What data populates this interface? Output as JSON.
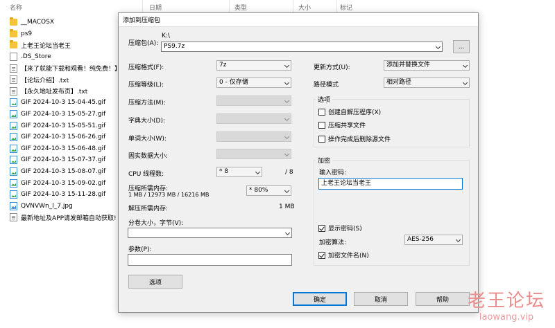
{
  "explorer": {
    "columns": [
      "名称",
      "日期",
      "类型",
      "大小",
      "标记"
    ],
    "files": [
      {
        "name": "__MACOSX",
        "kind": "folder"
      },
      {
        "name": "ps9",
        "kind": "folder"
      },
      {
        "name": "上老王论坛当老王",
        "kind": "folder"
      },
      {
        "name": ".DS_Store",
        "kind": "doc"
      },
      {
        "name": "【来了就能下载和观看！纯免费！】",
        "kind": "txt"
      },
      {
        "name": "【论坛介绍】.txt",
        "kind": "txt"
      },
      {
        "name": "【永久地址发布页】.txt",
        "kind": "txt"
      },
      {
        "name": "GIF 2024-10-3 15-04-45.gif",
        "kind": "gif"
      },
      {
        "name": "GIF 2024-10-3 15-05-27.gif",
        "kind": "gif"
      },
      {
        "name": "GIF 2024-10-3 15-05-51.gif",
        "kind": "gif"
      },
      {
        "name": "GIF 2024-10-3 15-06-26.gif",
        "kind": "gif"
      },
      {
        "name": "GIF 2024-10-3 15-06-48.gif",
        "kind": "gif"
      },
      {
        "name": "GIF 2024-10-3 15-07-37.gif",
        "kind": "gif"
      },
      {
        "name": "GIF 2024-10-3 15-08-07.gif",
        "kind": "gif"
      },
      {
        "name": "GIF 2024-10-3 15-09-02.gif",
        "kind": "gif"
      },
      {
        "name": "GIF 2024-10-3 15-11-28.gif",
        "kind": "gif"
      },
      {
        "name": "QVNVWn_l_7.jpg",
        "kind": "jpg"
      },
      {
        "name": "最新地址及APP请发邮箱自动获取!",
        "kind": "txt"
      }
    ]
  },
  "dialog": {
    "title": "添加到压缩包",
    "archive_label": "压缩包(A):",
    "archive_dir": "K:\\",
    "archive_name": "PS9.7z",
    "browse_label": "...",
    "format_label": "压缩格式(F):",
    "format_value": "7z",
    "level_label": "压缩等级(L):",
    "level_value": "0 - 仅存储",
    "method_label": "压缩方法(M):",
    "dict_label": "字典大小(D):",
    "word_label": "单词大小(W):",
    "solid_label": "固实数据大小:",
    "threads_label": "CPU 线程数:",
    "threads_value": "* 8",
    "threads_max": "/ 8",
    "mem_label": "压缩所需内存:",
    "mem_detail": "1 MB / 12973 MB / 16216 MB",
    "mem_value": "* 80%",
    "decomp_label": "解压所需内存:",
    "decomp_value": "1 MB",
    "split_label": "分卷大小，字节(V):",
    "params_label": "参数(P):",
    "options_button": "选项",
    "update_label": "更新方式(U):",
    "update_value": "添加并替换文件",
    "path_label": "路径模式",
    "path_value": "相对路径",
    "options_group": "选项",
    "opt_sfx": "创建自解压程序(X)",
    "opt_shared": "压缩共享文件",
    "opt_delete": "操作完成后删除源文件",
    "encrypt_group": "加密",
    "password_label": "输入密码:",
    "password_value": "上老王论坛当老王",
    "show_password": "显示密码(S)",
    "enc_method_label": "加密算法:",
    "enc_method_value": "AES-256",
    "encrypt_names": "加密文件名(N)",
    "ok": "确定",
    "cancel": "取消",
    "help": "帮助"
  },
  "watermark": {
    "line1": "老王论坛",
    "line2": "laowang.vip"
  },
  "colors": {
    "dialog_bg": "#f0f0f0",
    "accent": "#0078d7",
    "watermark": "#e88c8c"
  }
}
